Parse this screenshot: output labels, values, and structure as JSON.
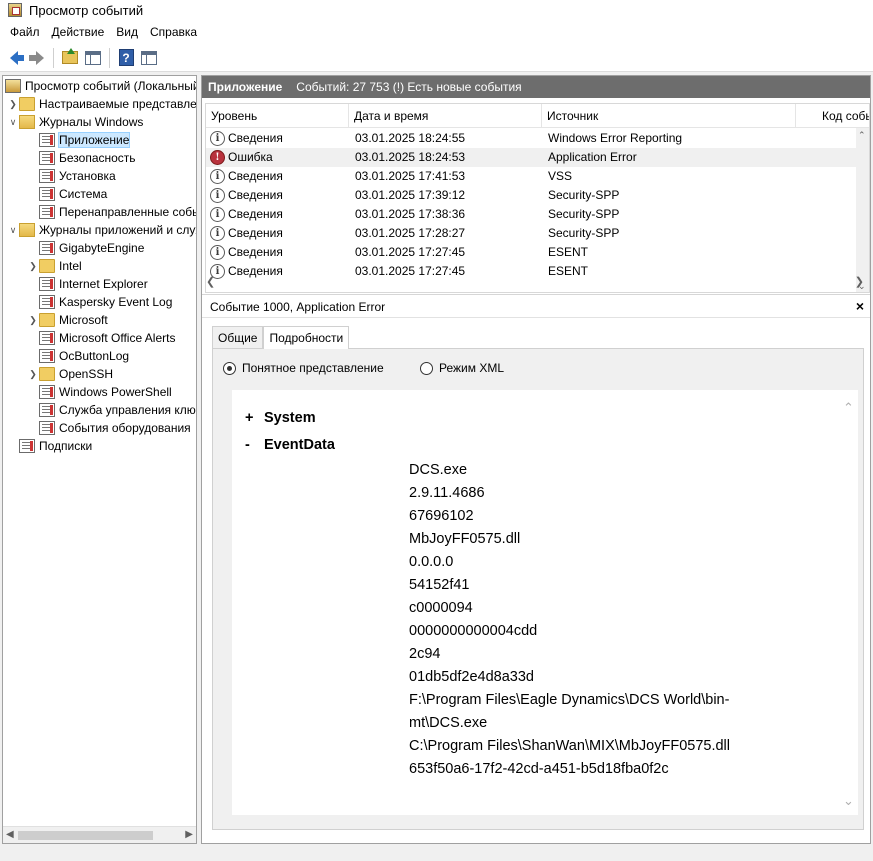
{
  "window": {
    "title": "Просмотр событий"
  },
  "menu": [
    "Файл",
    "Действие",
    "Вид",
    "Справка"
  ],
  "toolbar": {
    "icons": [
      "back-arrow-icon",
      "forward-arrow-icon",
      "folder-up-icon",
      "show-hide-pane-icon",
      "help-icon",
      "show-action-pane-icon"
    ]
  },
  "tree": {
    "root": "Просмотр событий (Локальный)",
    "items": [
      {
        "label": "Настраиваемые представления",
        "level": 1,
        "expander": "collapsed",
        "icon": "folder"
      },
      {
        "label": "Журналы Windows",
        "level": 1,
        "expander": "expanded",
        "icon": "folder-open"
      },
      {
        "label": "Приложение",
        "level": 2,
        "expander": "none",
        "icon": "log",
        "selected": true
      },
      {
        "label": "Безопасность",
        "level": 2,
        "expander": "none",
        "icon": "log"
      },
      {
        "label": "Установка",
        "level": 2,
        "expander": "none",
        "icon": "log"
      },
      {
        "label": "Система",
        "level": 2,
        "expander": "none",
        "icon": "log"
      },
      {
        "label": "Перенаправленные события",
        "level": 2,
        "expander": "none",
        "icon": "log"
      },
      {
        "label": "Журналы приложений и служб",
        "level": 1,
        "expander": "expanded",
        "icon": "folder-open"
      },
      {
        "label": "GigabyteEngine",
        "level": 2,
        "expander": "none",
        "icon": "log"
      },
      {
        "label": "Intel",
        "level": 2,
        "expander": "collapsed",
        "icon": "folder"
      },
      {
        "label": "Internet Explorer",
        "level": 2,
        "expander": "none",
        "icon": "log"
      },
      {
        "label": "Kaspersky Event Log",
        "level": 2,
        "expander": "none",
        "icon": "log"
      },
      {
        "label": "Microsoft",
        "level": 2,
        "expander": "collapsed",
        "icon": "folder"
      },
      {
        "label": "Microsoft Office Alerts",
        "level": 2,
        "expander": "none",
        "icon": "log"
      },
      {
        "label": "OcButtonLog",
        "level": 2,
        "expander": "none",
        "icon": "log"
      },
      {
        "label": "OpenSSH",
        "level": 2,
        "expander": "collapsed",
        "icon": "folder"
      },
      {
        "label": "Windows PowerShell",
        "level": 2,
        "expander": "none",
        "icon": "log"
      },
      {
        "label": "Служба управления ключами",
        "level": 2,
        "expander": "none",
        "icon": "log"
      },
      {
        "label": "События оборудования",
        "level": 2,
        "expander": "none",
        "icon": "log"
      },
      {
        "label": "Подписки",
        "level": 1,
        "expander": "none",
        "icon": "log"
      }
    ]
  },
  "section": {
    "title": "Приложение",
    "count": "Событий: 27 753 (!) Есть новые события"
  },
  "grid": {
    "columns": [
      "Уровень",
      "Дата и время",
      "Источник",
      "Код события"
    ],
    "rows": [
      {
        "level": "Сведения",
        "type": "info",
        "datetime": "03.01.2025 18:24:55",
        "source": "Windows Error Reporting"
      },
      {
        "level": "Ошибка",
        "type": "error",
        "datetime": "03.01.2025 18:24:53",
        "source": "Application Error",
        "highlight": true
      },
      {
        "level": "Сведения",
        "type": "info",
        "datetime": "03.01.2025 17:41:53",
        "source": "VSS"
      },
      {
        "level": "Сведения",
        "type": "info",
        "datetime": "03.01.2025 17:39:12",
        "source": "Security-SPP"
      },
      {
        "level": "Сведения",
        "type": "info",
        "datetime": "03.01.2025 17:38:36",
        "source": "Security-SPP"
      },
      {
        "level": "Сведения",
        "type": "info",
        "datetime": "03.01.2025 17:28:27",
        "source": "Security-SPP"
      },
      {
        "level": "Сведения",
        "type": "info",
        "datetime": "03.01.2025 17:27:45",
        "source": "ESENT"
      },
      {
        "level": "Сведения",
        "type": "info",
        "datetime": "03.01.2025 17:27:45",
        "source": "ESENT"
      }
    ]
  },
  "detail": {
    "title": "Событие 1000, Application Error",
    "close": "×",
    "tabs": [
      "Общие",
      "Подробности"
    ],
    "active_tab": "Подробности",
    "view_modes": [
      "Понятное представление",
      "Режим XML"
    ],
    "selected_mode": "Понятное представление",
    "sections": [
      {
        "sign": "+",
        "label": "System"
      },
      {
        "sign": "-",
        "label": "EventData"
      }
    ],
    "event_data": [
      "DCS.exe",
      "2.9.11.4686",
      "67696102",
      "MbJoyFF0575.dll",
      "0.0.0.0",
      "54152f41",
      "c0000094",
      "0000000000004cdd",
      "2c94",
      "01db5df2e4d8a33d",
      "F:\\Program Files\\Eagle Dynamics\\DCS World\\bin-",
      "mt\\DCS.exe",
      "C:\\Program Files\\ShanWan\\MIX\\MbJoyFF0575.dll",
      "653f50a6-17f2-42cd-a451-b5d18fba0f2c"
    ]
  }
}
